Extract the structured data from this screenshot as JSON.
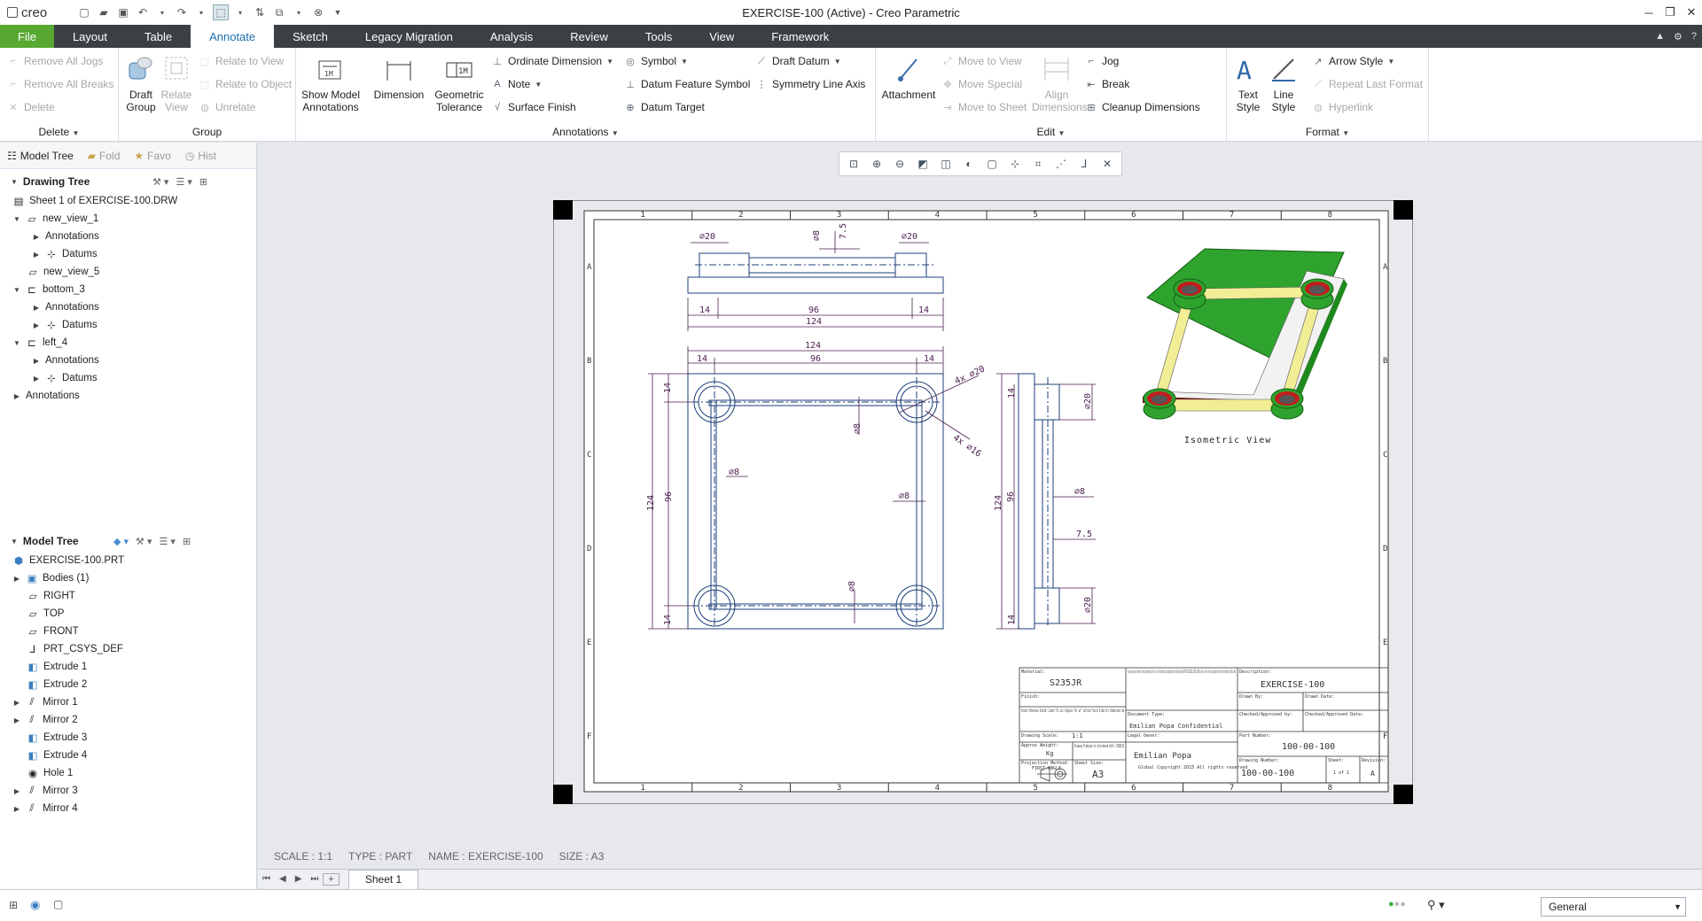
{
  "app": {
    "logo": "creo",
    "window_title": "EXERCISE-100 (Active) - Creo Parametric"
  },
  "tabs": [
    "File",
    "Layout",
    "Table",
    "Annotate",
    "Sketch",
    "Legacy Migration",
    "Analysis",
    "Review",
    "Tools",
    "View",
    "Framework"
  ],
  "active_tab": "Annotate",
  "ribbon": {
    "delete": {
      "items": [
        "Remove All Jogs",
        "Remove All Breaks",
        "Delete"
      ],
      "label": "Delete"
    },
    "group": {
      "draft_group": "Draft Group",
      "relate_view": "Relate View",
      "items": [
        "Relate to View",
        "Relate to Object",
        "Unrelate"
      ],
      "label": "Group"
    },
    "annotations": {
      "show_model": "Show Model Annotations",
      "dimension": "Dimension",
      "geom_tol": "Geometric Tolerance",
      "col1": [
        "Ordinate Dimension",
        "Note",
        "Surface Finish"
      ],
      "col2": [
        "Symbol",
        "Datum Feature Symbol",
        "Datum Target"
      ],
      "col3": [
        "Draft Datum",
        "Symmetry Line Axis"
      ],
      "label": "Annotations"
    },
    "edit": {
      "attachment": "Attachment",
      "move": [
        "Move to View",
        "Move Special",
        "Move to Sheet"
      ],
      "align": "Align Dimensions",
      "right": [
        "Jog",
        "Break",
        "Cleanup Dimensions"
      ],
      "label": "Edit"
    },
    "format": {
      "text_style": "Text Style",
      "line_style": "Line Style",
      "items": [
        "Arrow Style",
        "Repeat Last Format",
        "Hyperlink"
      ],
      "label": "Format"
    }
  },
  "panel_tabs": [
    "Model Tree",
    "Fold",
    "Favo",
    "Hist"
  ],
  "drawing_tree": {
    "title": "Drawing Tree",
    "nodes": [
      "Sheet 1 of EXERCISE-100.DRW",
      "new_view_1",
      "Annotations",
      "Datums",
      "new_view_5",
      "bottom_3",
      "Annotations",
      "Datums",
      "left_4",
      "Annotations",
      "Datums",
      "Annotations"
    ]
  },
  "model_tree": {
    "title": "Model Tree",
    "nodes": [
      "EXERCISE-100.PRT",
      "Bodies (1)",
      "RIGHT",
      "TOP",
      "FRONT",
      "PRT_CSYS_DEF",
      "Extrude 1",
      "Extrude 2",
      "Mirror 1",
      "Mirror 2",
      "Extrude 3",
      "Extrude 4",
      "Hole 1",
      "Mirror 3",
      "Mirror 4"
    ]
  },
  "status": {
    "scale": "SCALE : 1:1",
    "type": "TYPE : PART",
    "name": "NAME : EXERCISE-100",
    "size": "SIZE : A3"
  },
  "sheet_tab": "Sheet 1",
  "filter": "General",
  "drawing": {
    "zone_cols": [
      "1",
      "2",
      "3",
      "4",
      "5",
      "6",
      "7",
      "8"
    ],
    "zone_rows": [
      "A",
      "B",
      "C",
      "D",
      "E",
      "F"
    ],
    "top_view_dims": [
      "⌀20",
      "⌀8",
      "7.5",
      "⌀20",
      "14",
      "96",
      "14",
      "124"
    ],
    "front_view_dims": [
      "124",
      "14",
      "96",
      "14",
      "4x ⌀20",
      "4x ⌀16",
      "⌀8",
      "⌀8",
      "⌀8",
      "⌀8",
      "124",
      "96",
      "14",
      "14"
    ],
    "side_view_dims": [
      "14",
      "⌀20",
      "124",
      "96",
      "⌀8",
      "7.5",
      "14",
      "⌀20"
    ],
    "iso_label": "Isometric View",
    "title_block": {
      "material_label": "Material:",
      "material": "S235JR",
      "finish_label": "Finish:",
      "notes": "Unless Otherwise Stated: Linear Tol ±0.2 Angular Tol ±½° Surface Finish 0.8μm All Dimensions mm",
      "scale_label": "Drawing Scale:",
      "scale": "1:1",
      "weight_label": "Approx Weight:",
      "weight": "Kg",
      "produced": "Drawing Produced in Accordance With: ISO8015",
      "proj_label": "Projection Method:",
      "proj": "FIRST ANGLE",
      "size_label": "Sheet Size:",
      "size": "A3",
      "confidential_text": "This drawing and any information or descriptive material set out on it are the confidential and copyright property of Emilian Popa and MUST NOT BE DISCLOSED, COPIED, LOANED in whole or part or used for any purpose without the written permission of Emilian Popa",
      "doc_type_label": "Document Type:",
      "doc_type": "Emilian Popa Confidential",
      "legal_label": "Legal Owner:",
      "legal": "Emilian Popa",
      "legal_sub": "Global Copyright 2015 All rights reserved",
      "desc_label": "Description:",
      "desc": "EXERCISE-100",
      "drawn_label": "Drawn By:",
      "drawn_date": "Drawn Date:",
      "checked_label": "Checked/Approved by:",
      "checked_date": "Checked/Approved Date:",
      "part_label": "Part Number:",
      "part": "100-00-100",
      "dwg_label": "Drawing Number:",
      "dwg": "100-00-100",
      "sheet_label": "Sheet:",
      "sheet": "1 of 1",
      "rev_label": "Revision:",
      "rev": "A"
    }
  },
  "colors": {
    "file_tab": "#58a832",
    "tab_bar": "#3b4044",
    "active_tab_text": "#1a6fb0",
    "geometry": "#1c3f78",
    "dims": "#4b1e4e",
    "iso_frame": "#f2ee95",
    "iso_post": "#2ea32e",
    "iso_hole": "#c21d1d"
  }
}
